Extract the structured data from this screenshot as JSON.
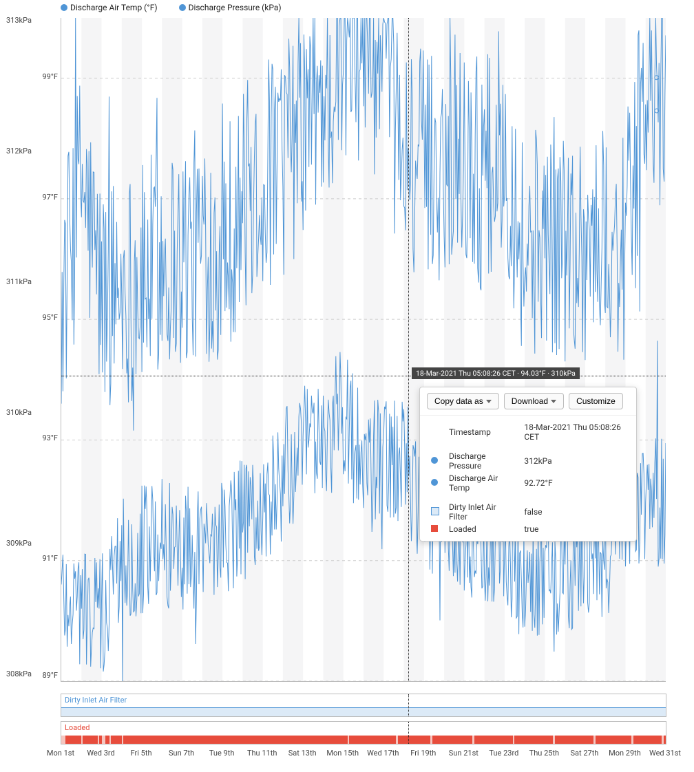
{
  "legend": {
    "series1": "Discharge Air Temp (°F)",
    "series2": "Discharge Pressure (kPa)"
  },
  "axis_left_kpa": [
    "313kPa",
    "312kPa",
    "311kPa",
    "310kPa",
    "309kPa",
    "308kPa"
  ],
  "axis_left_f": [
    "99°F",
    "97°F",
    "95°F",
    "93°F",
    "91°F",
    "89°F"
  ],
  "x_ticks": [
    "Mon 1st",
    "Wed 3rd",
    "Fri 5th",
    "Sun 7th",
    "Tue 9th",
    "Thu 11th",
    "Sat 13th",
    "Mon 15th",
    "Wed 17th",
    "Fri 19th",
    "Sun 21st",
    "Tue 23rd",
    "Thu 25th",
    "Sat 27th",
    "Mon 29th",
    "Wed 31st"
  ],
  "crosshair": {
    "label": "18-Mar-2021 Thu 05:08:26 CET · 94.03°F · 310kPa"
  },
  "popup": {
    "toolbar": {
      "copy": "Copy data as",
      "download": "Download",
      "customize": "Customize"
    },
    "rows": {
      "timestamp_label": "Timestamp",
      "timestamp_val": "18-Mar-2021 Thu 05:08:26 CET",
      "dp_label": "Discharge Pressure",
      "dp_val": "312kPa",
      "dat_label": "Discharge Air Temp",
      "dat_val": "92.72°F",
      "dirty_label": "Dirty Inlet Air Filter",
      "dirty_val": "false",
      "loaded_label": "Loaded",
      "loaded_val": "true"
    }
  },
  "state_charts": {
    "dirty": "Dirty Inlet Air Filter",
    "loaded": "Loaded"
  },
  "colors": {
    "series": "#4f95d6",
    "loaded": "#e74c3c",
    "loaded_mute": "#f6c6c0",
    "dirty_fill": "#dceaf7",
    "dirty_border": "#4f95d6"
  },
  "chart_data": {
    "type": "line",
    "title": "",
    "xlabel": "",
    "x_domain": [
      "2021-03-01",
      "2021-03-31"
    ],
    "y_axes": [
      {
        "name": "Discharge Pressure",
        "unit": "kPa",
        "range": [
          308,
          313
        ]
      },
      {
        "name": "Discharge Air Temp",
        "unit": "°F",
        "range": [
          89,
          100
        ]
      }
    ],
    "x_ticks": [
      "Mon 1st",
      "Wed 3rd",
      "Fri 5th",
      "Sun 7th",
      "Tue 9th",
      "Thu 11th",
      "Sat 13th",
      "Mon 15th",
      "Wed 17th",
      "Fri 19th",
      "Sun 21st",
      "Tue 23rd",
      "Thu 25th",
      "Sat 27th",
      "Mon 29th",
      "Wed 31st"
    ],
    "crosshair_sample": {
      "timestamp": "18-Mar-2021 Thu 05:08:26 CET",
      "Discharge Pressure": "312kPa",
      "Discharge Air Temp": "92.72°F",
      "Dirty Inlet Air Filter": false,
      "Loaded": true,
      "cursor_readout": "94.03°F · 310kPa"
    },
    "series": [
      {
        "name": "Discharge Pressure (kPa)",
        "axis": "Discharge Pressure",
        "x": [
          1,
          2,
          3,
          4,
          5,
          6,
          7,
          8,
          9,
          10,
          11,
          12,
          13,
          14,
          15,
          16,
          17,
          18,
          19,
          20,
          21,
          22,
          23,
          24,
          25,
          26,
          27,
          28,
          29,
          30,
          31
        ],
        "values": [
          310.8,
          311.8,
          310.9,
          311.0,
          311.0,
          311.2,
          311.2,
          311.3,
          311.3,
          311.6,
          311.8,
          311.9,
          312.2,
          312.4,
          312.6,
          312.9,
          312.5,
          312.0,
          311.9,
          311.9,
          312.0,
          311.8,
          312.1,
          311.2,
          311.4,
          311.3,
          311.3,
          311.3,
          311.3,
          312.4,
          312.3
        ],
        "note": "approximate daily centerline read from gridlines; actual plot is high-frequency noisy"
      },
      {
        "name": "Discharge Air Temp (°F)",
        "axis": "Discharge Air Temp",
        "x": [
          1,
          2,
          3,
          4,
          5,
          6,
          7,
          8,
          9,
          10,
          11,
          12,
          13,
          14,
          15,
          16,
          17,
          18,
          19,
          20,
          21,
          22,
          23,
          24,
          25,
          26,
          27,
          28,
          29,
          30,
          31
        ],
        "values": [
          90.5,
          90.3,
          90.0,
          91.1,
          91.2,
          91.3,
          91.2,
          91.3,
          91.4,
          91.6,
          91.8,
          92.4,
          92.8,
          93.0,
          93.5,
          92.5,
          92.6,
          92.7,
          91.8,
          92.0,
          91.5,
          91.2,
          91.3,
          90.6,
          90.8,
          90.9,
          91.0,
          91.0,
          92.0,
          92.0,
          92.0
        ],
        "note": "approximate daily centerline of lower trace"
      }
    ],
    "state_series": [
      {
        "name": "Dirty Inlet Air Filter",
        "type": "boolean",
        "mostly": false
      },
      {
        "name": "Loaded",
        "type": "boolean",
        "mostly": true,
        "false_segments_days": [
          [
            1.0,
            1.2
          ],
          [
            2.0,
            2.05
          ],
          [
            2.8,
            2.85
          ],
          [
            3.0,
            3.2
          ],
          [
            3.4,
            3.45
          ],
          [
            4.0,
            4.05
          ],
          [
            15.2,
            15.25
          ],
          [
            17.6,
            17.7
          ],
          [
            19.3,
            19.4
          ],
          [
            21.4,
            21.5
          ],
          [
            23.4,
            23.5
          ],
          [
            25.4,
            25.5
          ],
          [
            27.4,
            27.5
          ],
          [
            29.3,
            29.4
          ],
          [
            30.8,
            30.9
          ]
        ]
      }
    ]
  }
}
